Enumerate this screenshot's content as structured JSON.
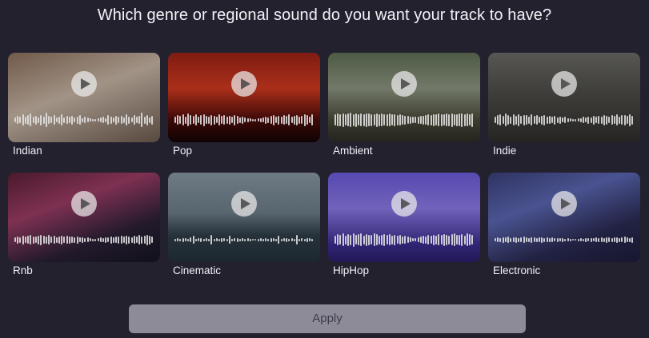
{
  "title": "Which genre or regional sound do you want your track to have?",
  "genres": [
    {
      "label": "Indian",
      "bg": "linear-gradient(160deg,#8a6e5a 0%,#c5b4a4 45%,#6b5a4e 100%)"
    },
    {
      "label": "Pop",
      "bg": "linear-gradient(180deg,#9c2216 0%,#d03a20 40%,#4a0c0a 75%,#120404 100%)"
    },
    {
      "label": "Ambient",
      "bg": "linear-gradient(180deg,#5f6f55 0%,#8c9480 40%,#4a4a3a 75%,#2e2b25 100%)"
    },
    {
      "label": "Indie",
      "bg": "linear-gradient(180deg,#6b6a65 0%,#4d4c48 45%,#2e2d2a 100%)"
    },
    {
      "label": "Rnb",
      "bg": "linear-gradient(160deg,#5a2036 0%,#9a3c64 35%,#2a2036 70%,#151520 100%)"
    },
    {
      "label": "Cinematic",
      "bg": "linear-gradient(180deg,#8796a2 0%,#6b7c88 45%,#2f3d47 70%,#23303a 100%)"
    },
    {
      "label": "HipHop",
      "bg": "linear-gradient(180deg,#6a5ad8 0%,#8a78e4 40%,#3b2d8e 80%,#2a1f6a 100%)"
    },
    {
      "label": "Electronic",
      "bg": "linear-gradient(160deg,#3a3f78 0%,#5a66b0 35%,#2a2a52 70%,#1c1c3a 100%)"
    }
  ],
  "apply_label": "Apply"
}
